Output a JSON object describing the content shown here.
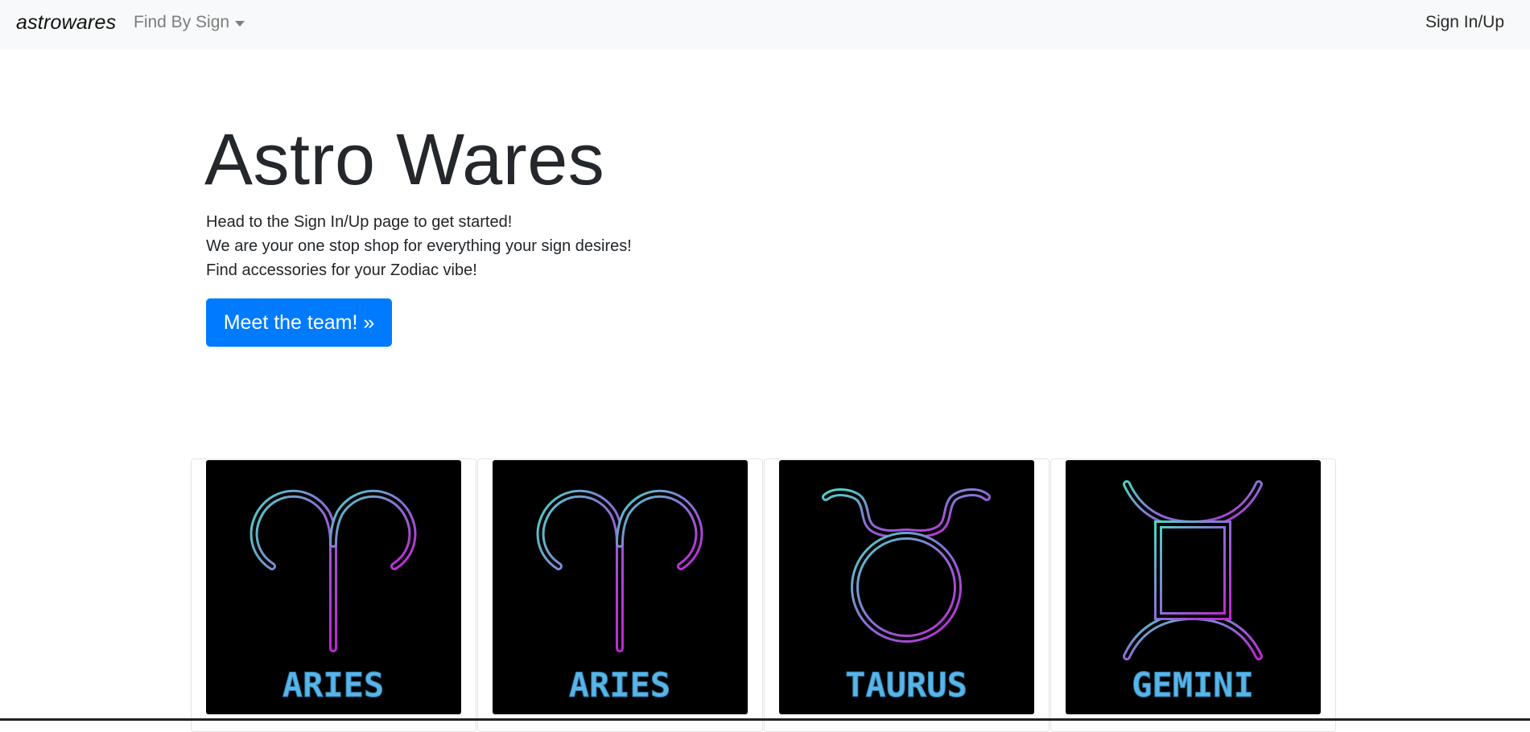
{
  "navbar": {
    "brand": "astrowares",
    "dropdown_label": "Find By Sign",
    "signin_label": "Sign In/Up"
  },
  "hero": {
    "title": "Astro Wares",
    "lines": [
      "Head to the Sign In/Up page to get started!",
      "We are your one stop shop for everything your sign desires!",
      "Find accessories for your Zodiac vibe!"
    ],
    "cta_label": "Meet the team! »"
  },
  "products": [
    {
      "sign": "ARIES",
      "icon": "aries-sign-icon"
    },
    {
      "sign": "ARIES",
      "icon": "aries-sign-icon"
    },
    {
      "sign": "TAURUS",
      "icon": "taurus-sign-icon"
    },
    {
      "sign": "GEMINI",
      "icon": "gemini-sign-icon"
    }
  ],
  "colors": {
    "navbar_bg": "#f8f9fa",
    "primary": "#007bff",
    "neon_teal": "#4fd1c5",
    "neon_magenta": "#c026d3",
    "neon_blue_text": "#5ab4e6"
  }
}
